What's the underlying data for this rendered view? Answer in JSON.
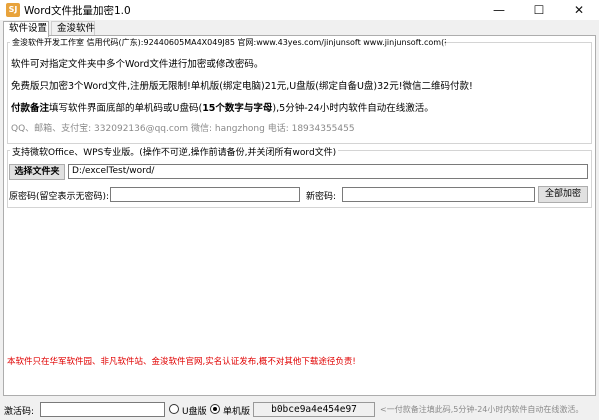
{
  "window": {
    "icon_text": "SJ",
    "title": "Word文件批量加密1.0",
    "min_glyph": "—",
    "max_glyph": "☐",
    "close_glyph": "✕"
  },
  "tabs": [
    {
      "label": "软件设置",
      "active": true
    },
    {
      "label": "金浚软件",
      "active": false
    }
  ],
  "info": {
    "group_title": "金浚软件开发工作室 信用代码(广东):92440605MA4X049J85 官网:www.43yes.com/jinjunsoft  www.jinjunsoft.com(在建)",
    "line1": "软件可对指定文件夹中多个Word文件进行加密或修改密码。",
    "line2": "免费版只加密3个Word文件,注册版无限制!单机版(绑定电脑)21元,U盘版(绑定自备U盘)32元!微信二维码付款!",
    "line3_bold": "付款备注",
    "line3_rest": "填写软件界面底部的单机码或U盘码(",
    "line3_bold2": "15个数字与字母",
    "line3_end": "),5分钟-24小时内软件自动在线激活。",
    "contact": "QQ、邮箱、支付宝: 332092136@qq.com    微信: hangzhong    电话: 18934355455"
  },
  "settings": {
    "group_title": "支持微软Office、WPS专业版。(操作不可逆,操作前请备份,并关闭所有word文件)",
    "select_folder_label": "选择文件夹",
    "folder_path": "D:/excelTest/word/",
    "old_pwd_label": "原密码(留空表示无密码):",
    "old_pwd_value": "",
    "new_pwd_label": "新密码:",
    "new_pwd_value": "",
    "encrypt_all_label": "全部加密"
  },
  "notice": {
    "text": "本软件只在华军软件园、非凡软件站、金浚软件官网,实名认证发布,概不对其他下载途径负责!",
    "color": "#e00000"
  },
  "statusbar": {
    "activation_label": "激活码:",
    "activation_value": "",
    "usb_label": "U盘版",
    "standalone_label": "单机版",
    "selected": "单机版",
    "machine_code": "b0bce9a4e454e97",
    "hint": "<一付款备注填此码,5分钟-24小时内软件自动在线激活。"
  }
}
